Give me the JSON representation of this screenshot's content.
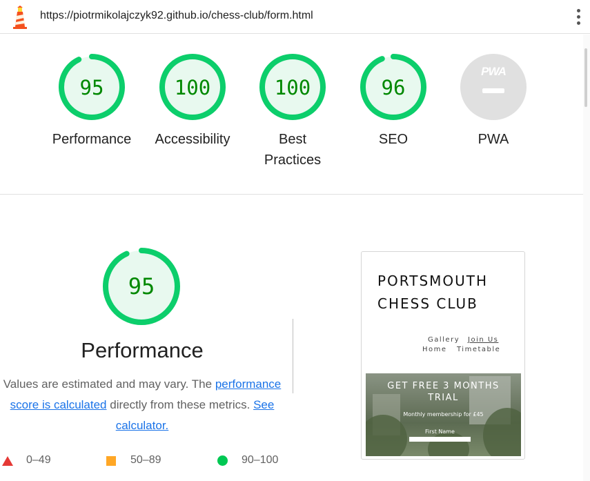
{
  "url_bar": {
    "url": "https://piotrmikolajczyk92.github.io/chess-club/form.html",
    "logo_icon": "lighthouse-icon",
    "menu_icon": "kebab-menu-icon"
  },
  "summary": {
    "gauges": [
      {
        "score": "95",
        "label": "Performance",
        "value": 0.95,
        "color": "#0cce6b"
      },
      {
        "score": "100",
        "label": "Accessibility",
        "value": 1.0,
        "color": "#0cce6b"
      },
      {
        "score": "100",
        "label": "Best Practices",
        "value": 1.0,
        "color": "#0cce6b"
      },
      {
        "score": "96",
        "label": "SEO",
        "value": 0.96,
        "color": "#0cce6b"
      }
    ],
    "pwa": {
      "badge_text": "PWA",
      "label": "PWA"
    }
  },
  "performance": {
    "score": "95",
    "value": 0.95,
    "title": "Performance",
    "desc_before": "Values are estimated and may vary. The ",
    "desc_link1": "performance score is calculated",
    "desc_middle": " directly from these metrics. ",
    "desc_link2": "See calculator."
  },
  "legend": {
    "fail": "0–49",
    "average": "50–89",
    "pass": "90–100",
    "colors": {
      "fail": "#e53935",
      "average": "#ffa726",
      "pass": "#00c853"
    }
  },
  "preview": {
    "title_line1": "PORTSMOUTH",
    "title_line2": "CHESS CLUB",
    "nav": {
      "gallery": "Gallery",
      "join": "Join Us",
      "home": "Home",
      "timetable": "Timetable"
    },
    "hero_title_line1": "GET FREE 3 MONTHS",
    "hero_title_line2": "TRIAL",
    "hero_subtitle": "Monthly membership for £45",
    "hero_field_label": "First Name"
  }
}
